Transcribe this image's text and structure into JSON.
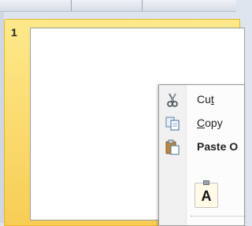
{
  "slide_panel": {
    "slide_number": "1"
  },
  "context_menu": {
    "items": [
      {
        "before": "Cu",
        "underline": "t",
        "after": "",
        "icon": "scissors-icon",
        "bold": false
      },
      {
        "before": "",
        "underline": "C",
        "after": "opy",
        "icon": "copy-icon",
        "bold": false
      },
      {
        "before": "Paste O",
        "underline": "",
        "after": "",
        "icon": "clipboard-icon",
        "bold": true
      }
    ],
    "paste_option_letter": "A"
  },
  "colors": {
    "selection_gold": "#f7cd55",
    "menu_background": "#fcfcfc",
    "panel_background": "#dfe5ee"
  }
}
